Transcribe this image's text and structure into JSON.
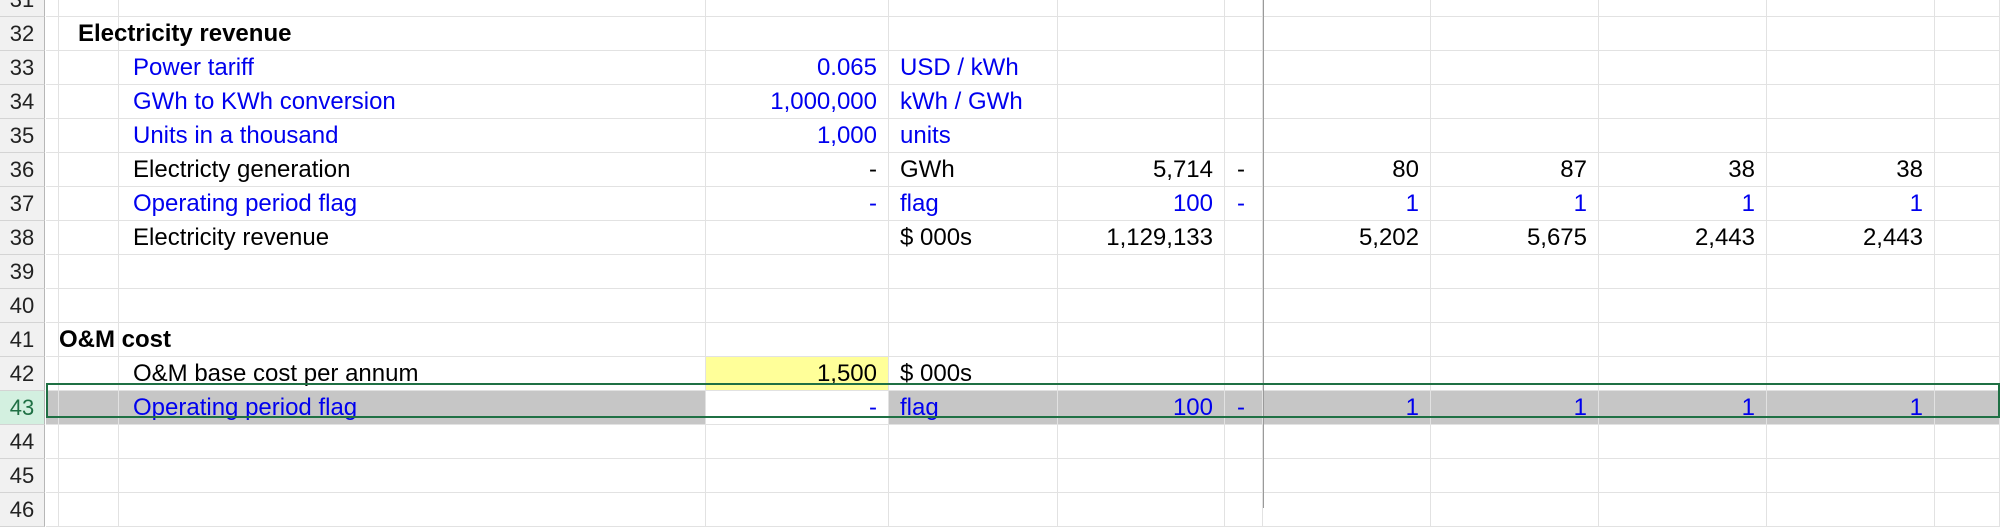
{
  "sheet": {
    "rows": [
      {
        "num": "31",
        "cells": {}
      },
      {
        "num": "32",
        "cells": {
          "heading": "Electricity revenue"
        }
      },
      {
        "num": "33",
        "cells": {
          "label": "Power tariff",
          "label_color": "#0000ee",
          "value": "0.065",
          "value_color": "#0000ee",
          "unit": "USD / kWh",
          "unit_color": "#0000ee"
        }
      },
      {
        "num": "34",
        "cells": {
          "label": "GWh to KWh conversion",
          "label_color": "#0000ee",
          "value": "1,000,000",
          "value_color": "#0000ee",
          "unit": "kWh / GWh",
          "unit_color": "#0000ee"
        }
      },
      {
        "num": "35",
        "cells": {
          "label": "Units in a thousand",
          "label_color": "#0000ee",
          "value": "1,000",
          "value_color": "#0000ee",
          "unit": "units",
          "unit_color": "#0000ee"
        }
      },
      {
        "num": "36",
        "cells": {
          "label": "Electricty generation",
          "label_color": "#000000",
          "value": "-",
          "value_color": "#000000",
          "unit": "GWh",
          "unit_color": "#000000",
          "total": "5,714",
          "total_color": "#000000",
          "dash": "-",
          "dash_color": "#000000",
          "p1": "80",
          "p2": "87",
          "p3": "38",
          "p4": "38",
          "p_color": "#000000"
        }
      },
      {
        "num": "37",
        "cells": {
          "label": "Operating period flag",
          "label_color": "#0000ee",
          "value": "-",
          "value_color": "#0000ee",
          "unit": "flag",
          "unit_color": "#0000ee",
          "total": "100",
          "total_color": "#0000ee",
          "dash": "-",
          "dash_color": "#0000ee",
          "p1": "1",
          "p2": "1",
          "p3": "1",
          "p4": "1",
          "p_color": "#0000ee"
        }
      },
      {
        "num": "38",
        "cells": {
          "label": "Electricity revenue",
          "label_color": "#000000",
          "unit": "$ 000s",
          "unit_color": "#000000",
          "total": "1,129,133",
          "total_color": "#000000",
          "p1": "5,202",
          "p2": "5,675",
          "p3": "2,443",
          "p4": "2,443",
          "p_color": "#000000"
        }
      },
      {
        "num": "39",
        "cells": {}
      },
      {
        "num": "40",
        "cells": {}
      },
      {
        "num": "41",
        "cells": {
          "heading2": "O&M cost"
        }
      },
      {
        "num": "42",
        "cells": {
          "label": "O&M base cost per annum",
          "label_color": "#000000",
          "value": "1,500",
          "value_color": "#000000",
          "value_bg": "#ffff99",
          "unit": "$ 000s",
          "unit_color": "#000000"
        }
      },
      {
        "num": "43",
        "selected": true,
        "cells": {
          "label": "Operating period flag",
          "label_color": "#0000ee",
          "value": "-",
          "value_color": "#0000ee",
          "unit": "flag",
          "unit_color": "#0000ee",
          "total": "100",
          "total_color": "#0000ee",
          "dash": "-",
          "dash_color": "#0000ee",
          "p1": "1",
          "p2": "1",
          "p3": "1",
          "p4": "1",
          "p_color": "#0000ee"
        }
      },
      {
        "num": "44",
        "cells": {}
      },
      {
        "num": "45",
        "cells": {}
      },
      {
        "num": "46",
        "cells": {}
      }
    ]
  },
  "colors": {
    "selection_fill": "#c6c6c6",
    "selection_outline": "#1f7044",
    "active_cell": "#ffffff",
    "input_highlight": "#ffff99",
    "row_header_selected": "#d3f0e0"
  }
}
